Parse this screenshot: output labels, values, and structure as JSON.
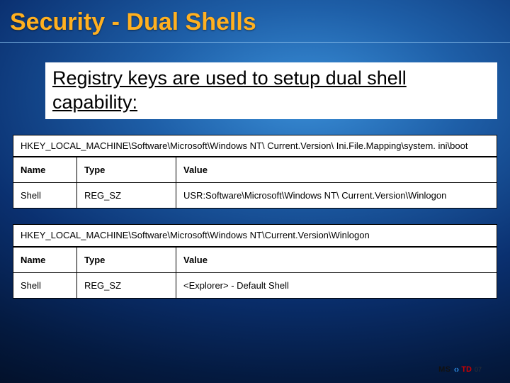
{
  "title": "Security - Dual Shells",
  "subtitle": "Registry keys are used to setup dual shell capability:",
  "tables": [
    {
      "path": "HKEY_LOCAL_MACHINE\\Software\\Microsoft\\Windows NT\\ Current.Version\\ Ini.File.Mapping\\system. ini\\boot",
      "headers": {
        "name": "Name",
        "type": "Type",
        "value": "Value"
      },
      "row": {
        "name": "Shell",
        "type": "REG_SZ",
        "value": "USR:Software\\Microsoft\\Windows NT\\ Current.Version\\Winlogon"
      }
    },
    {
      "path": "HKEY_LOCAL_MACHINE\\Software\\Microsoft\\Windows NT\\Current.Version\\Winlogon",
      "headers": {
        "name": "Name",
        "type": "Type",
        "value": "Value"
      },
      "row": {
        "name": "Shell",
        "type": "REG_SZ",
        "value": "<Explorer> - Default Shell"
      }
    }
  ],
  "footer": {
    "ms": "MS",
    "arrows": "‹›",
    "td": "TD",
    "year": "07"
  }
}
